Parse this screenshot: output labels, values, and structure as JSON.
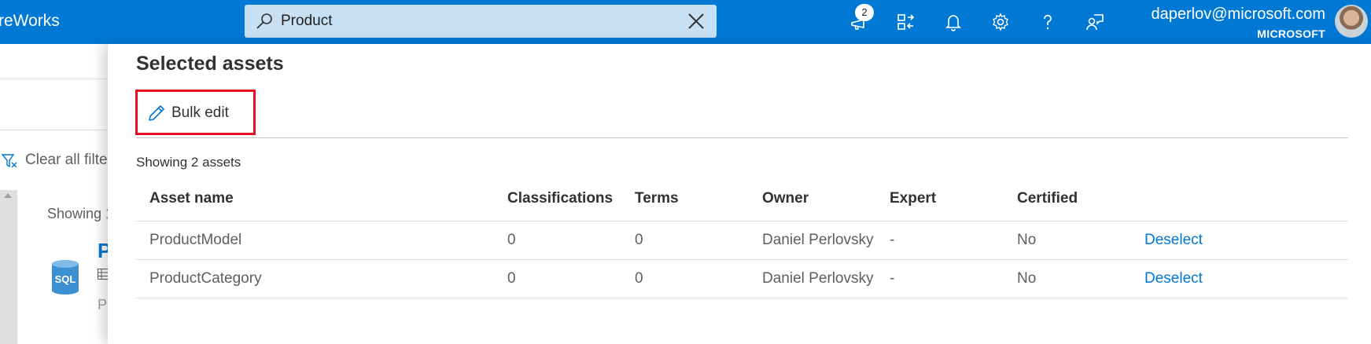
{
  "topbar": {
    "brand": "reWorks",
    "search_value": "Product",
    "badge_count": "2",
    "user_email": "daperlov@microsoft.com",
    "user_org": "MICROSOFT",
    "accent": "#0078d4"
  },
  "background": {
    "clear_filters": "Clear all filte",
    "showing_partial": "Showing 1",
    "sql_label": "SQL",
    "result_initial": "P",
    "result_sub_initial": "P"
  },
  "panel": {
    "title": "Selected assets",
    "bulk_edit_label": "Bulk edit",
    "showing_text": "Showing 2 assets",
    "columns": [
      "Asset name",
      "Classifications",
      "Terms",
      "Owner",
      "Expert",
      "Certified"
    ],
    "rows": [
      {
        "asset_name": "ProductModel",
        "classifications": "0",
        "terms": "0",
        "owner": "Daniel Perlovsky",
        "expert": "-",
        "certified": "No",
        "action": "Deselect"
      },
      {
        "asset_name": "ProductCategory",
        "classifications": "0",
        "terms": "0",
        "owner": "Daniel Perlovsky",
        "expert": "-",
        "certified": "No",
        "action": "Deselect"
      }
    ],
    "highlight_color": "#e81123"
  }
}
